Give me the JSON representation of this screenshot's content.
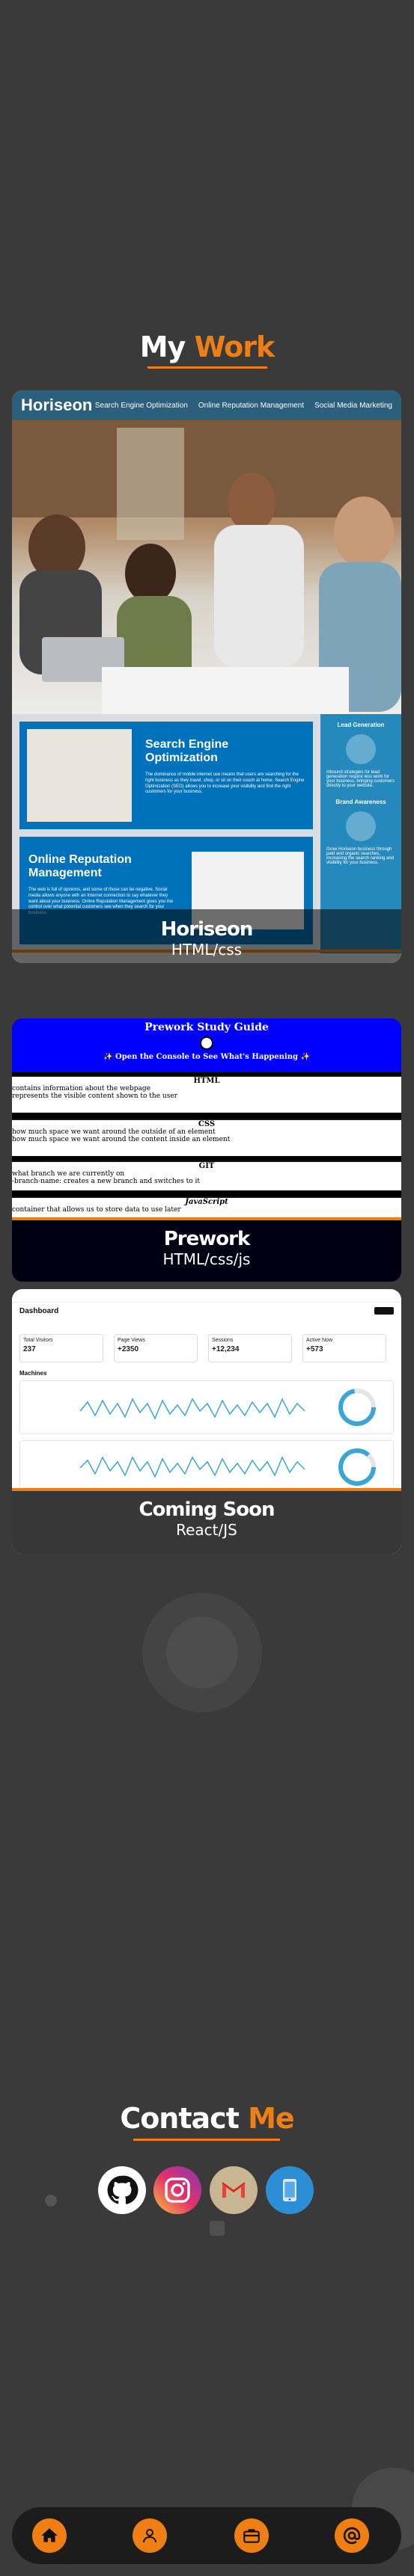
{
  "work": {
    "title_white": "My",
    "title_accent": "Work"
  },
  "horiseon": {
    "logo": "Horiseon",
    "nav": [
      "Search Engine Optimization",
      "Online Reputation Management",
      "Social Media Marketing"
    ],
    "seo_heading": "Search Engine Optimization",
    "seo_text": "The dominance of mobile internet use means that users are searching for the right business as they travel, shop, or sit on their couch at home. Search Engine Optimization (SEO) allows you to increase your visibility and find the right customers for your business.",
    "orm_heading": "Online Reputation Management",
    "orm_text": "The web is full of opinions, and some of those can be negative. Social media allows anyone with an Internet connection to say whatever they want about your business. Online Reputation Management gives you the control over what potential customers see when they search for your business.",
    "aside_lead": "Lead Generation",
    "aside_lead_text": "Inbound strategies for lead generation require less work for your business, bringing customers directly to your website.",
    "aside_brand": "Brand Awareness",
    "aside_brand_text": "Grow Horiseon business through paid and organic searches, increasing the search ranking and visibility for your business.",
    "card_title": "Horiseon",
    "card_sub": "HTML/css"
  },
  "prework": {
    "header": "Prework Study Guide",
    "banner": "✨ Open the Console to See What's Happening ✨",
    "html_head": "HTML",
    "html_lines": [
      "contains information about the webpage",
      "represents the visible content shown to the user"
    ],
    "css_head": "CSS",
    "css_lines": [
      "how much space we want around the outside of an element",
      "how much space we want around the content inside an element"
    ],
    "git_head": "GIT",
    "git_lines": [
      "what branch we are currently on",
      "-branch-name: creates a new branch and switches to it"
    ],
    "js_head": "JavaScript",
    "js_lines": [
      "container that allows us to store data to use later"
    ],
    "card_title": "Prework",
    "card_sub": "HTML/css/js"
  },
  "dashboard": {
    "page_title": "Dashboard",
    "kpis": [
      {
        "label": "Total Visitors",
        "value": "237"
      },
      {
        "label": "Page Views",
        "value": "+2350"
      },
      {
        "label": "Sessions",
        "value": "+12,234"
      },
      {
        "label": "Active Now",
        "value": "+573"
      }
    ],
    "section": "Machines",
    "card_title": "Coming Soon",
    "card_sub": "React/JS"
  },
  "contact": {
    "title_white": "Contact",
    "title_accent": "Me"
  },
  "colors": {
    "accent": "#f07f13",
    "background": "#3a3a3a",
    "nav": "#1c1c1c"
  },
  "icons": {
    "contact": [
      "github-icon",
      "instagram-icon",
      "gmail-icon",
      "phone-icon"
    ],
    "nav": [
      "home-icon",
      "user-icon",
      "briefcase-icon",
      "at-icon"
    ]
  }
}
